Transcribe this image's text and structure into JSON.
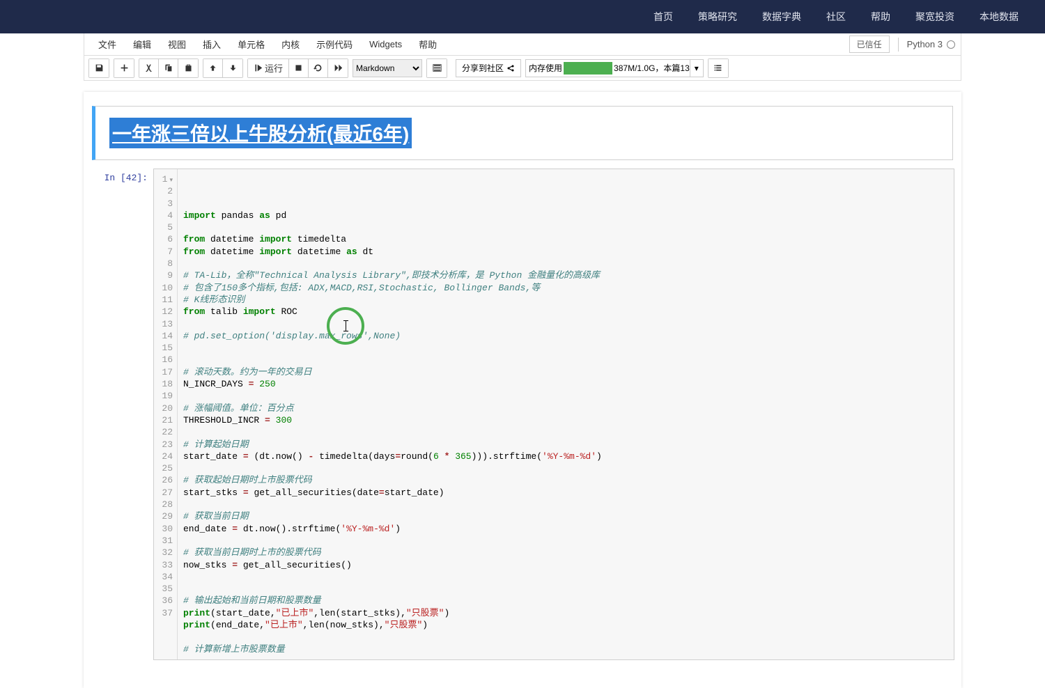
{
  "topnav": {
    "items": [
      "首页",
      "策略研究",
      "数据字典",
      "社区",
      "帮助",
      "聚宽投资",
      "本地数据"
    ]
  },
  "menubar": {
    "items": [
      "文件",
      "编辑",
      "视图",
      "插入",
      "单元格",
      "内核",
      "示例代码",
      "Widgets",
      "帮助"
    ],
    "trusted": "已信任",
    "kernel": "Python 3"
  },
  "toolbar": {
    "run": "运行",
    "celltype": "Markdown",
    "share": "分享到社区",
    "mem_label": "内存使用",
    "mem_value": "387M/1.0G，本篇13"
  },
  "markdown_cell": {
    "title": "一年涨三倍以上牛股分析(最近6年)"
  },
  "code_cell": {
    "prompt": "In [42]:",
    "lines": [
      {
        "n": 1,
        "type": "code",
        "segs": [
          {
            "t": "import",
            "c": "kw"
          },
          {
            "t": " pandas ",
            "c": "nm"
          },
          {
            "t": "as",
            "c": "kw"
          },
          {
            "t": " pd",
            "c": "nm"
          }
        ]
      },
      {
        "n": 2,
        "type": "blank"
      },
      {
        "n": 3,
        "type": "code",
        "segs": [
          {
            "t": "from",
            "c": "kw"
          },
          {
            "t": " datetime ",
            "c": "nm"
          },
          {
            "t": "import",
            "c": "kw"
          },
          {
            "t": " timedelta",
            "c": "nm"
          }
        ]
      },
      {
        "n": 4,
        "type": "code",
        "segs": [
          {
            "t": "from",
            "c": "kw"
          },
          {
            "t": " datetime ",
            "c": "nm"
          },
          {
            "t": "import",
            "c": "kw"
          },
          {
            "t": " datetime ",
            "c": "nm"
          },
          {
            "t": "as",
            "c": "kw"
          },
          {
            "t": " dt",
            "c": "nm"
          }
        ]
      },
      {
        "n": 5,
        "type": "blank"
      },
      {
        "n": 6,
        "type": "comment",
        "text": "# TA-Lib，全称\"Technical Analysis Library\",即技术分析库，是 Python 金融量化的高级库"
      },
      {
        "n": 7,
        "type": "comment",
        "text": "# 包含了150多个指标,包括: ADX,MACD,RSI,Stochastic, Bollinger Bands,等"
      },
      {
        "n": 8,
        "type": "comment",
        "text": "# K线形态识别"
      },
      {
        "n": 9,
        "type": "code",
        "segs": [
          {
            "t": "from",
            "c": "kw"
          },
          {
            "t": " talib ",
            "c": "nm"
          },
          {
            "t": "import",
            "c": "kw"
          },
          {
            "t": " ROC",
            "c": "nm"
          }
        ]
      },
      {
        "n": 10,
        "type": "blank"
      },
      {
        "n": 11,
        "type": "comment",
        "text": "# pd.set_option('display.max_rows',None)"
      },
      {
        "n": 12,
        "type": "blank"
      },
      {
        "n": 13,
        "type": "blank"
      },
      {
        "n": 14,
        "type": "comment",
        "text": "# 滚动天数。约为一年的交易日"
      },
      {
        "n": 15,
        "type": "code",
        "segs": [
          {
            "t": "N_INCR_DAYS ",
            "c": "nm"
          },
          {
            "t": "=",
            "c": "op"
          },
          {
            "t": " ",
            "c": "nm"
          },
          {
            "t": "250",
            "c": "num"
          }
        ]
      },
      {
        "n": 16,
        "type": "blank"
      },
      {
        "n": 17,
        "type": "comment",
        "text": "# 涨幅阈值。单位：百分点"
      },
      {
        "n": 18,
        "type": "code",
        "segs": [
          {
            "t": "THRESHOLD_INCR ",
            "c": "nm"
          },
          {
            "t": "=",
            "c": "op"
          },
          {
            "t": " ",
            "c": "nm"
          },
          {
            "t": "300",
            "c": "num"
          }
        ]
      },
      {
        "n": 19,
        "type": "blank"
      },
      {
        "n": 20,
        "type": "comment",
        "text": "# 计算起始日期"
      },
      {
        "n": 21,
        "type": "code",
        "segs": [
          {
            "t": "start_date ",
            "c": "nm"
          },
          {
            "t": "=",
            "c": "op"
          },
          {
            "t": " (dt.now() ",
            "c": "nm"
          },
          {
            "t": "-",
            "c": "op"
          },
          {
            "t": " timedelta(days",
            "c": "nm"
          },
          {
            "t": "=",
            "c": "op"
          },
          {
            "t": "round(",
            "c": "nm"
          },
          {
            "t": "6",
            "c": "num"
          },
          {
            "t": " ",
            "c": "nm"
          },
          {
            "t": "*",
            "c": "op"
          },
          {
            "t": " ",
            "c": "nm"
          },
          {
            "t": "365",
            "c": "num"
          },
          {
            "t": "))).strftime(",
            "c": "nm"
          },
          {
            "t": "'%Y-%m-%d'",
            "c": "str"
          },
          {
            "t": ")",
            "c": "nm"
          }
        ]
      },
      {
        "n": 22,
        "type": "blank"
      },
      {
        "n": 23,
        "type": "comment",
        "text": "# 获取起始日期时上市股票代码"
      },
      {
        "n": 24,
        "type": "code",
        "segs": [
          {
            "t": "start_stks ",
            "c": "nm"
          },
          {
            "t": "=",
            "c": "op"
          },
          {
            "t": " get_all_securities(date",
            "c": "nm"
          },
          {
            "t": "=",
            "c": "op"
          },
          {
            "t": "start_date)",
            "c": "nm"
          }
        ]
      },
      {
        "n": 25,
        "type": "blank"
      },
      {
        "n": 26,
        "type": "comment",
        "text": "# 获取当前日期"
      },
      {
        "n": 27,
        "type": "code",
        "segs": [
          {
            "t": "end_date ",
            "c": "nm"
          },
          {
            "t": "=",
            "c": "op"
          },
          {
            "t": " dt.now().strftime(",
            "c": "nm"
          },
          {
            "t": "'%Y-%m-%d'",
            "c": "str"
          },
          {
            "t": ")",
            "c": "nm"
          }
        ]
      },
      {
        "n": 28,
        "type": "blank"
      },
      {
        "n": 29,
        "type": "comment",
        "text": "# 获取当前日期时上市的股票代码"
      },
      {
        "n": 30,
        "type": "code",
        "segs": [
          {
            "t": "now_stks ",
            "c": "nm"
          },
          {
            "t": "=",
            "c": "op"
          },
          {
            "t": " get_all_securities()",
            "c": "nm"
          }
        ]
      },
      {
        "n": 31,
        "type": "blank"
      },
      {
        "n": 32,
        "type": "blank"
      },
      {
        "n": 33,
        "type": "comment",
        "text": "# 输出起始和当前日期和股票数量"
      },
      {
        "n": 34,
        "type": "code",
        "segs": [
          {
            "t": "print",
            "c": "kw"
          },
          {
            "t": "(start_date,",
            "c": "nm"
          },
          {
            "t": "\"已上市\"",
            "c": "str"
          },
          {
            "t": ",len(start_stks),",
            "c": "nm"
          },
          {
            "t": "\"只股票\"",
            "c": "str"
          },
          {
            "t": ")",
            "c": "nm"
          }
        ]
      },
      {
        "n": 35,
        "type": "code",
        "segs": [
          {
            "t": "print",
            "c": "kw"
          },
          {
            "t": "(end_date,",
            "c": "nm"
          },
          {
            "t": "\"已上市\"",
            "c": "str"
          },
          {
            "t": ",len(now_stks),",
            "c": "nm"
          },
          {
            "t": "\"只股票\"",
            "c": "str"
          },
          {
            "t": ")",
            "c": "nm"
          }
        ]
      },
      {
        "n": 36,
        "type": "blank"
      },
      {
        "n": 37,
        "type": "comment",
        "text": "# 计算新增上市股票数量"
      }
    ]
  }
}
